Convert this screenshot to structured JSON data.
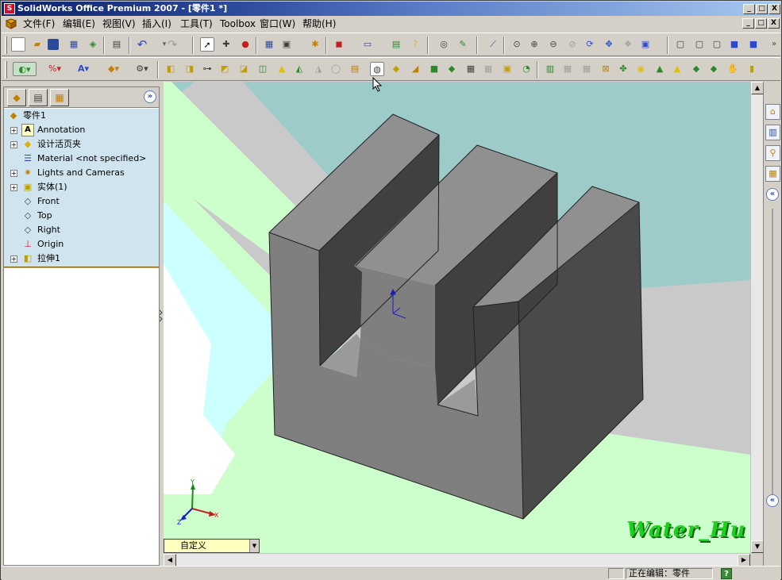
{
  "window": {
    "title": "SolidWorks Office Premium 2007 - [零件1 *]",
    "app_icon": "solidworks-logo-icon",
    "controls": [
      "_",
      "□",
      "X"
    ]
  },
  "menu": {
    "items": [
      "文件(F)",
      "编辑(E)",
      "视图(V)",
      "插入(I)",
      "工具(T)",
      "Toolbox",
      "窗口(W)",
      "帮助(H)"
    ],
    "mdi_controls": [
      "_",
      "□",
      "X"
    ]
  },
  "feature_tree": {
    "root": "零件1",
    "items": [
      {
        "label": "Annotation",
        "icon": "annotation-icon",
        "expandable": true
      },
      {
        "label": "设计活页夹",
        "icon": "design-binder-icon",
        "expandable": true
      },
      {
        "label": "Material <not specified>",
        "icon": "material-icon",
        "expandable": false
      },
      {
        "label": "Lights and Cameras",
        "icon": "lights-icon",
        "expandable": true
      },
      {
        "label": "实体(1)",
        "icon": "solid-bodies-icon",
        "expandable": true
      },
      {
        "label": "Front",
        "icon": "plane-icon",
        "expandable": false
      },
      {
        "label": "Top",
        "icon": "plane-icon",
        "expandable": false
      },
      {
        "label": "Right",
        "icon": "plane-icon",
        "expandable": false
      },
      {
        "label": "Origin",
        "icon": "origin-icon",
        "expandable": false
      },
      {
        "label": "拉伸1",
        "icon": "extrude-icon",
        "expandable": true
      }
    ]
  },
  "viewport": {
    "view_orientation": "自定义",
    "watermark": "Water_Hu",
    "triad": {
      "x": "X",
      "y": "Y",
      "z": "Z"
    }
  },
  "status": {
    "editing": "正在编辑：零件",
    "help": "?"
  },
  "colors": {
    "accent": "#0a246a",
    "part": "#7f7f7f",
    "background_teal": "#9ccbc9",
    "background_green": "#ccffcc",
    "watermark": "#1bd11b"
  }
}
